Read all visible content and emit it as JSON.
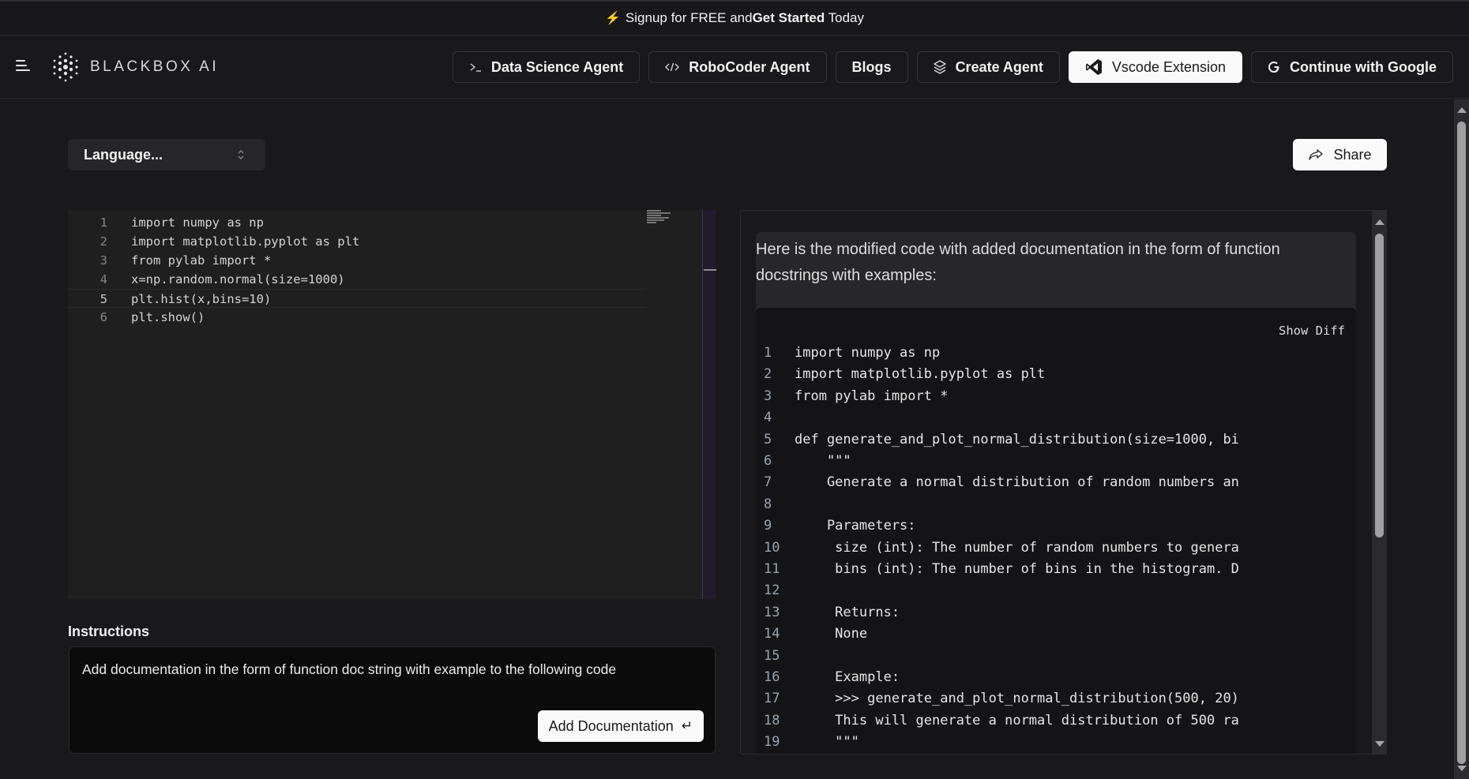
{
  "banner": {
    "icon": "lightning-bolt-icon",
    "prefix": "Signup for FREE and ",
    "bold": "Get Started",
    "suffix": " Today"
  },
  "navbar": {
    "logo_text": "BLACKBOX AI",
    "buttons": [
      {
        "label": "Data Science Agent",
        "icon": "terminal-icon"
      },
      {
        "label": "RoboCoder Agent",
        "icon": "code-icon"
      },
      {
        "label": "Blogs",
        "icon": null
      },
      {
        "label": "Create Agent",
        "icon": "layers-icon"
      },
      {
        "label": "Vscode Extension",
        "icon": "vscode-icon"
      },
      {
        "label": "Continue with Google",
        "icon": "google-icon"
      }
    ]
  },
  "toolbar": {
    "language_placeholder": "Language...",
    "share_label": "Share"
  },
  "editor": {
    "active_line": 5,
    "lines": [
      {
        "n": "1",
        "code": "import numpy as np"
      },
      {
        "n": "2",
        "code": "import matplotlib.pyplot as plt"
      },
      {
        "n": "3",
        "code": "from pylab import *"
      },
      {
        "n": "4",
        "code": "x=np.random.normal(size=1000)"
      },
      {
        "n": "5",
        "code": "plt.hist(x,bins=10)"
      },
      {
        "n": "6",
        "code": "plt.show()"
      }
    ]
  },
  "instructions": {
    "label": "Instructions",
    "text": "Add documentation in the form of function doc string with example to the following code",
    "submit_label": "Add Documentation",
    "submit_icon": "↵"
  },
  "output": {
    "intro": "Here is the modified code with added documentation in the form of function docstrings with examples:",
    "show_diff_label": "Show Diff",
    "lines": [
      {
        "n": "1",
        "code": "import numpy as np"
      },
      {
        "n": "2",
        "code": "import matplotlib.pyplot as plt"
      },
      {
        "n": "3",
        "code": "from pylab import *"
      },
      {
        "n": "4",
        "code": ""
      },
      {
        "n": "5",
        "code": "def generate_and_plot_normal_distribution(size=1000, bi"
      },
      {
        "n": "6",
        "code": "    \"\"\""
      },
      {
        "n": "7",
        "code": "    Generate a normal distribution of random numbers an"
      },
      {
        "n": "8",
        "code": ""
      },
      {
        "n": "9",
        "code": "    Parameters:"
      },
      {
        "n": "10",
        "code": "     size (int): The number of random numbers to genera"
      },
      {
        "n": "11",
        "code": "     bins (int): The number of bins in the histogram. D"
      },
      {
        "n": "12",
        "code": ""
      },
      {
        "n": "13",
        "code": "     Returns:"
      },
      {
        "n": "14",
        "code": "     None"
      },
      {
        "n": "15",
        "code": ""
      },
      {
        "n": "16",
        "code": "     Example:"
      },
      {
        "n": "17",
        "code": "     >>> generate_and_plot_normal_distribution(500, 20)"
      },
      {
        "n": "18",
        "code": "     This will generate a normal distribution of 500 ra"
      },
      {
        "n": "19",
        "code": "     \"\"\""
      }
    ]
  }
}
